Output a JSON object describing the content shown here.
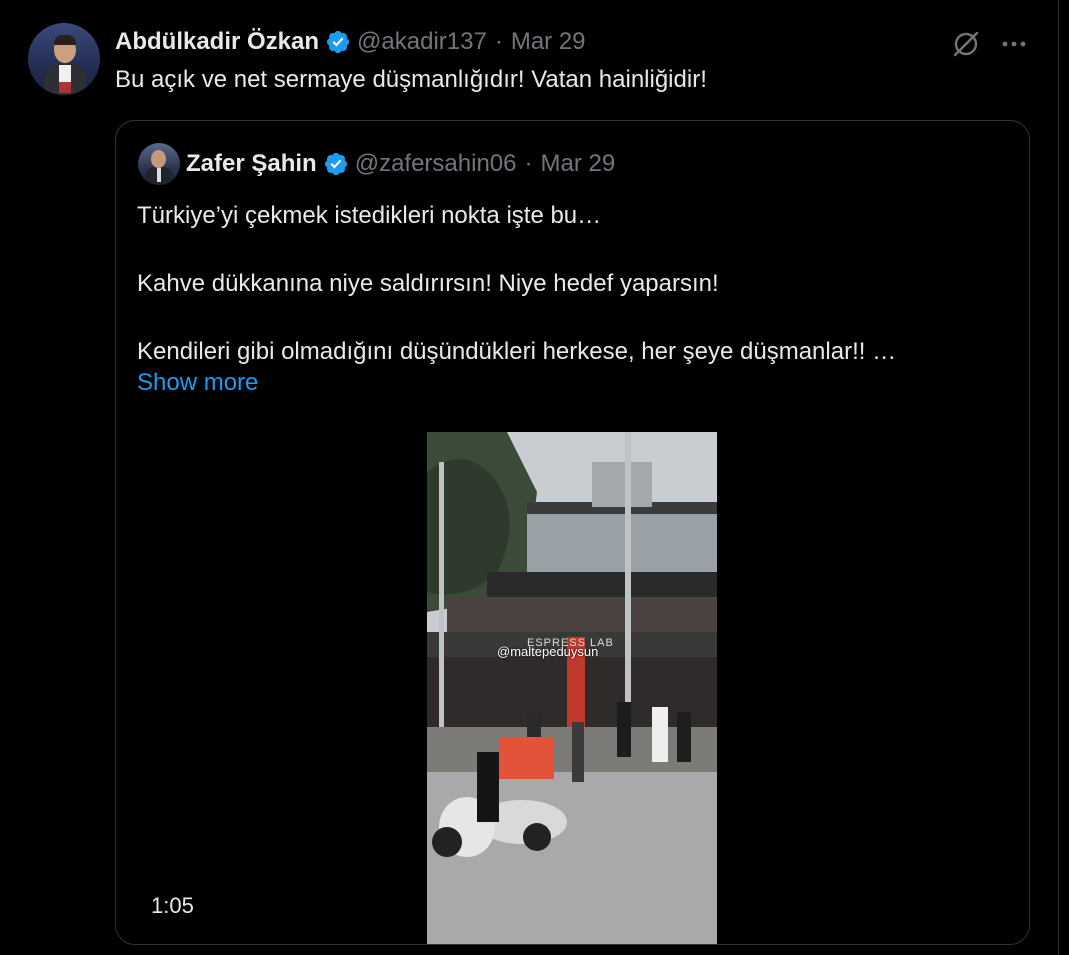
{
  "tweet": {
    "author_name": "Abdülkadir Özkan",
    "handle": "@akadir137",
    "separator": "·",
    "date": "Mar 29",
    "text": "Bu açık ve net sermaye düşmanlığıdır! Vatan hainliğidir!"
  },
  "quoted": {
    "author_name": "Zafer Şahin",
    "handle": "@zafersahin06",
    "separator": "·",
    "date": "Mar 29",
    "lines": [
      "Türkiye’yi çekmek istedikleri nokta işte bu…",
      "Kahve dükkanına niye saldırırsın! Niye hedef yaparsın!",
      "Kendileri gibi olmadığını düşündükleri herkese, her şeye düşmanlar!! …"
    ],
    "show_more": "Show more",
    "video": {
      "duration": "1:05",
      "watermark": "@maltepeduysun",
      "sign_text": "ESPRESS LAB"
    }
  },
  "icons": {
    "verified": "verified-badge-icon",
    "grok": "grok-icon",
    "more": "more-options-icon"
  },
  "colors": {
    "background": "#000000",
    "text": "#e7e9ea",
    "muted": "#71767b",
    "accent": "#1d9bf0",
    "border": "#2f3336"
  }
}
